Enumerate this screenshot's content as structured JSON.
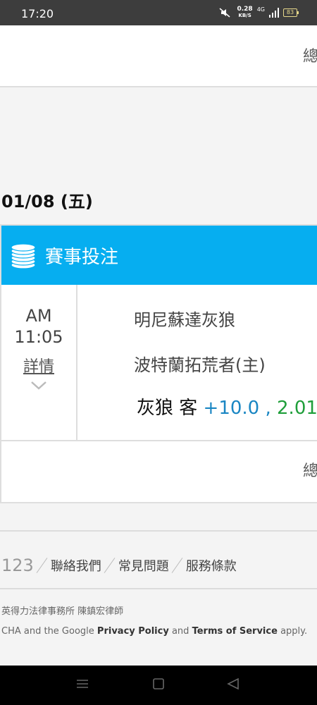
{
  "status_bar": {
    "time": "17:20",
    "net_speed": "0.28",
    "net_unit": "KB/S",
    "network_type": "4G",
    "battery": "83"
  },
  "top_card": {
    "total_label": "總"
  },
  "date_heading": "01/08 (五)",
  "event_section": {
    "title": "賽事投注",
    "ampm": "AM",
    "time": "11:05",
    "detail_link": "詳情",
    "away_team": "明尼蘇達灰狼",
    "home_team": "波特蘭拓荒者(主)",
    "bet": {
      "team": "灰狼 客",
      "handicap": "+10.0",
      "separator": ",",
      "odds": "2.01"
    },
    "total_label": "總"
  },
  "footer": {
    "count": "123",
    "links": [
      "聯絡我們",
      "常見問題",
      "服務條款"
    ],
    "law_firm": "英得力法律事務所 陳鎮宏律師",
    "recaptcha_prefix": "CHA and the Google",
    "privacy_link": "Privacy Policy",
    "and_text": "and",
    "terms_link": "Terms of Service",
    "apply_text": "apply."
  },
  "colors": {
    "header_blue": "#06aef0",
    "handicap_blue": "#1a86c3",
    "odds_green": "#1f9e3a"
  }
}
